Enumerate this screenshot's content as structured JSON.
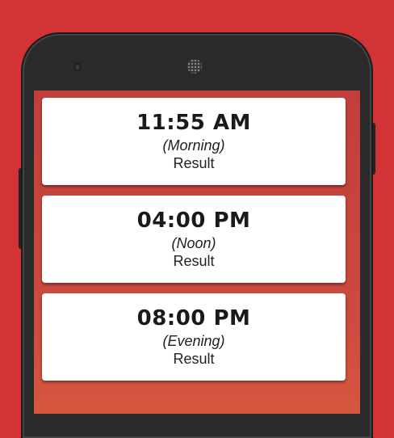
{
  "cards": [
    {
      "time": "11:55 AM",
      "period": "(Morning)",
      "result": "Result"
    },
    {
      "time": "04:00 PM",
      "period": "(Noon)",
      "result": "Result"
    },
    {
      "time": "08:00 PM",
      "period": "(Evening)",
      "result": "Result"
    }
  ]
}
